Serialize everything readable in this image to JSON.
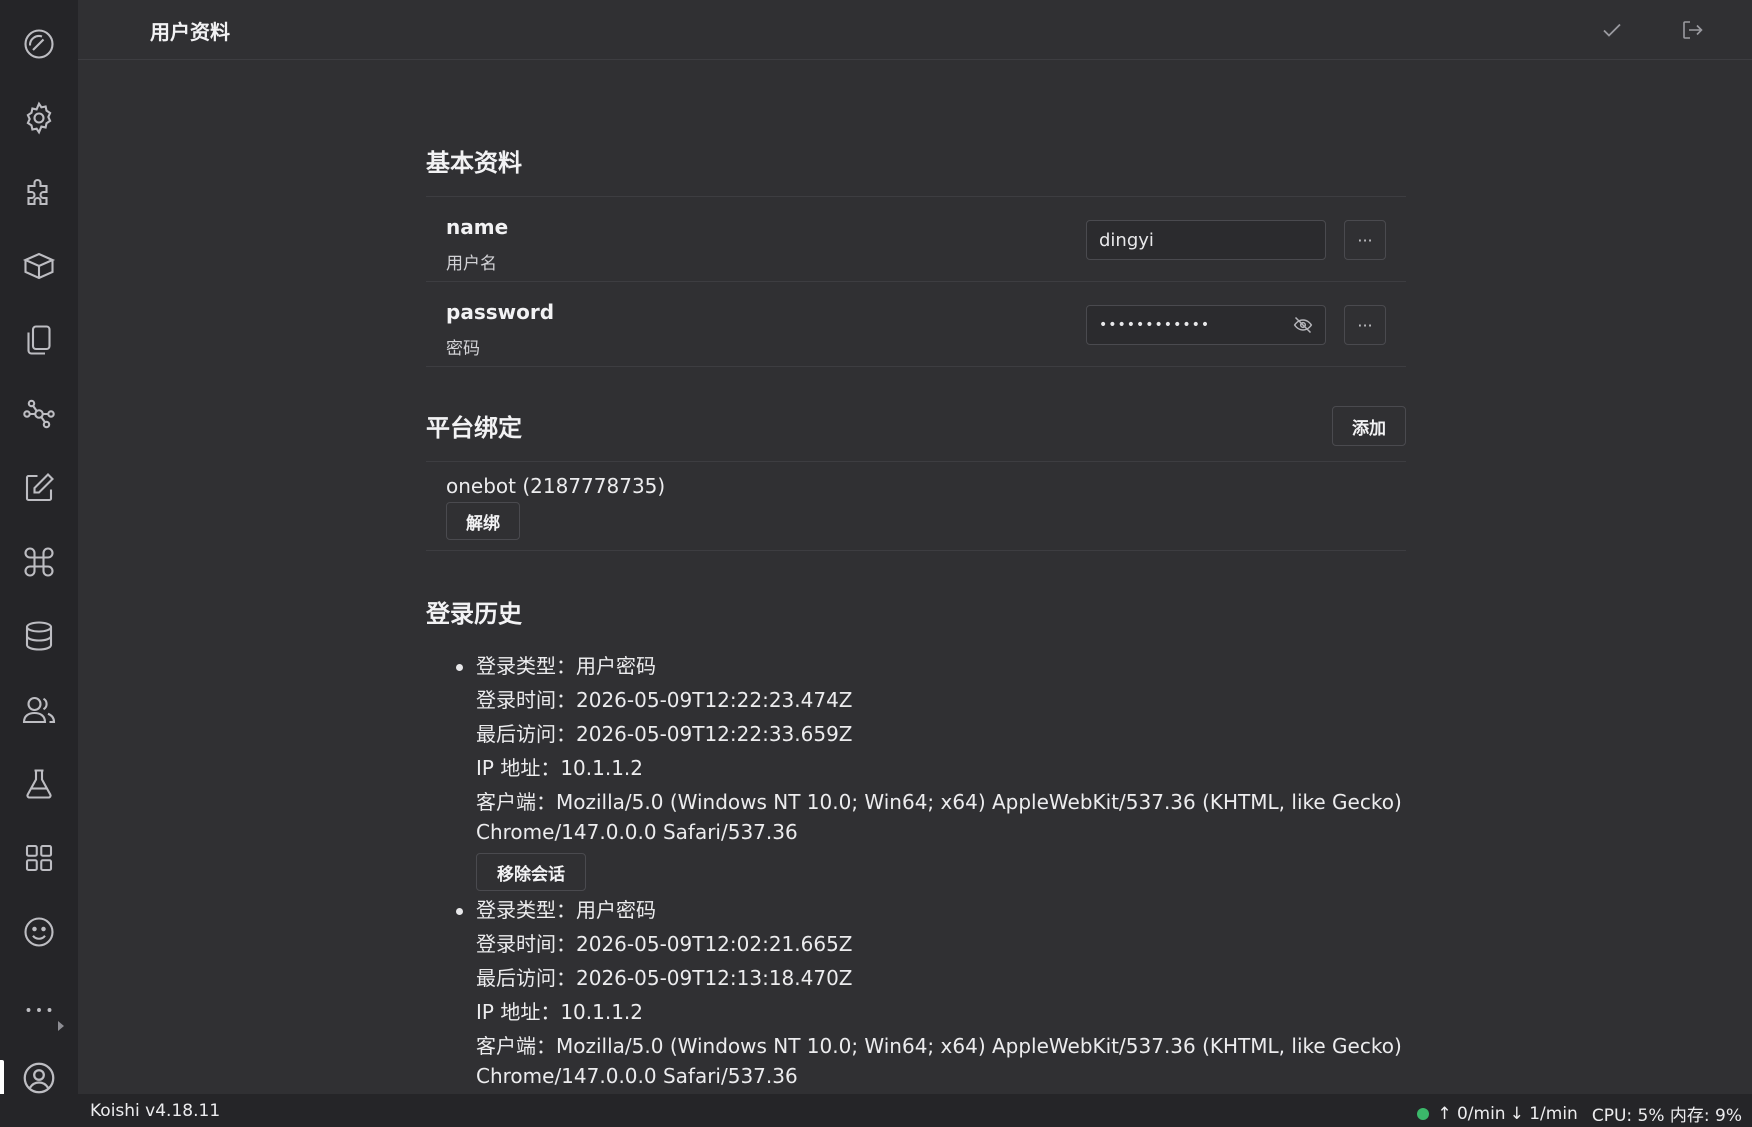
{
  "header": {
    "title": "用户资料",
    "save_icon": "check-icon",
    "logout_icon": "logout-icon"
  },
  "sidebar": {
    "items": [
      {
        "name": "dashboard-icon"
      },
      {
        "name": "settings-icon"
      },
      {
        "name": "plugin-icon"
      },
      {
        "name": "market-icon"
      },
      {
        "name": "files-icon"
      },
      {
        "name": "dependencies-icon"
      },
      {
        "name": "editor-icon"
      },
      {
        "name": "command-icon"
      },
      {
        "name": "database-icon"
      },
      {
        "name": "users-icon"
      },
      {
        "name": "sandbox-icon"
      },
      {
        "name": "apps-icon"
      },
      {
        "name": "emoji-icon"
      },
      {
        "name": "more-icon"
      },
      {
        "name": "profile-icon"
      }
    ]
  },
  "basic": {
    "title": "基本资料",
    "fields": [
      {
        "key": "name",
        "label": "用户名",
        "value": "dingyi",
        "more": "···"
      },
      {
        "key": "password",
        "label": "密码",
        "value": "••••••••••••",
        "more": "···"
      }
    ]
  },
  "bindings": {
    "title": "平台绑定",
    "add_label": "添加",
    "items": [
      {
        "name": "onebot (2187778735)",
        "unbind_label": "解绑"
      }
    ]
  },
  "history": {
    "title": "登录历史",
    "items": [
      {
        "type": "登录类型：用户密码",
        "login_time": "登录时间：2026-05-09T12:22:23.474Z",
        "last_access": "最后访问：2026-05-09T12:22:33.659Z",
        "ip": "IP 地址：10.1.1.2",
        "client_1": "客户端：Mozilla/5.0 (Windows NT 10.0; Win64; x64) AppleWebKit/537.36 (KHTML, like Gecko)",
        "client_2": "Chrome/147.0.0.0 Safari/537.36",
        "remove_label": "移除会话"
      },
      {
        "type": "登录类型：用户密码",
        "login_time": "登录时间：2026-05-09T12:02:21.665Z",
        "last_access": "最后访问：2026-05-09T12:13:18.470Z",
        "ip": "IP 地址：10.1.1.2",
        "client_1": "客户端：Mozilla/5.0 (Windows NT 10.0; Win64; x64) AppleWebKit/537.36 (KHTML, like Gecko)",
        "client_2": "Chrome/147.0.0.0 Safari/537.36"
      }
    ]
  },
  "status": {
    "version": "Koishi v4.18.11",
    "up": "↑ 0/min",
    "down": "↓ 1/min",
    "cpu_mem": "CPU: 5% 内存: 9%",
    "online_color": "#3bb86a"
  }
}
